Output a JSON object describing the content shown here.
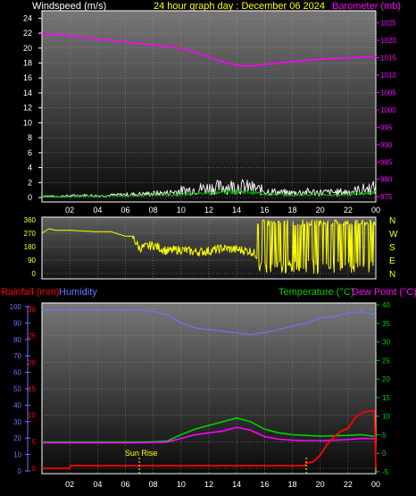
{
  "header": {
    "left_label": "Windspeed (m/s)",
    "title": "24 hour graph day : December 06 2024",
    "right_label": "Barometer (mb)"
  },
  "colors": {
    "windspeed": "#ffffff",
    "gust": "#ffffff",
    "avg_wind": "#00c000",
    "barometer": "#ff00ff",
    "direction": "#ffff00",
    "rainfall": "#ff0000",
    "humidity": "#7070ff",
    "temperature": "#00d000",
    "dewpoint": "#ff00ff",
    "title": "#ffff00",
    "text": "#ffffff"
  },
  "chart_data": [
    {
      "type": "line",
      "title": "24 hour graph day : December 06 2024",
      "xlabel": "",
      "x_ticks": [
        "02",
        "04",
        "06",
        "08",
        "10",
        "12",
        "14",
        "16",
        "18",
        "20",
        "22",
        "00"
      ],
      "xlim": [
        0,
        24
      ],
      "y_left": {
        "label": "Windspeed (m/s)",
        "ticks": [
          0,
          2,
          4,
          6,
          8,
          10,
          12,
          14,
          16,
          18,
          20,
          22,
          24
        ],
        "lim": [
          0,
          25
        ]
      },
      "y_right": {
        "label": "Barometer (mb)",
        "ticks": [
          975,
          980,
          985,
          990,
          995,
          1000,
          1005,
          1010,
          1015,
          1020,
          1025
        ],
        "lim": [
          973.5,
          1028.5
        ]
      },
      "grid": true,
      "series": [
        {
          "name": "Barometer (mb)",
          "axis": "right",
          "x": [
            0,
            1,
            2,
            3,
            4,
            5,
            6,
            7,
            8,
            9,
            10,
            11,
            12,
            13,
            14,
            15,
            16,
            17,
            18,
            19,
            20,
            21,
            22,
            23,
            24
          ],
          "values": [
            1022,
            1021.6,
            1021.2,
            1020.8,
            1020.4,
            1020,
            1019.5,
            1019.1,
            1018.6,
            1018.2,
            1017.6,
            1016.5,
            1015.2,
            1013.8,
            1012.8,
            1012.6,
            1013,
            1013.4,
            1013.9,
            1014.2,
            1014.6,
            1014.8,
            1014.9,
            1015.1,
            1015.3
          ]
        },
        {
          "axis": "left",
          "x": [
            0,
            1,
            2,
            3,
            4,
            5,
            6,
            7,
            8,
            9,
            10,
            11,
            12,
            13,
            14,
            15,
            16,
            17,
            18,
            19,
            20,
            21,
            22,
            23,
            24
          ],
          "values": [
            0.3,
            0.2,
            0.3,
            0.4,
            0.3,
            0.4,
            0.5,
            0.6,
            0.7,
            0.8,
            1.2,
            1.5,
            1.7,
            1.9,
            2.0,
            1.8,
            1.2,
            0.9,
            0.8,
            1.0,
            0.9,
            0.9,
            1.0,
            1.4,
            1.8
          ]
        },
        {
          "axis": "left",
          "x": [
            0,
            1,
            2,
            3,
            4,
            5,
            6,
            7,
            8,
            9,
            10,
            11,
            12,
            13,
            14,
            15,
            16,
            17,
            18,
            19,
            20,
            21,
            22,
            23,
            24
          ],
          "values": [
            0.1,
            0.1,
            0.1,
            0.2,
            0.2,
            0.2,
            0.2,
            0.3,
            0.3,
            0.3,
            0.4,
            0.5,
            0.6,
            0.7,
            0.8,
            0.7,
            0.5,
            0.4,
            0.3,
            0.4,
            0.4,
            0.3,
            0.4,
            0.5,
            0.7
          ]
        }
      ]
    },
    {
      "type": "line",
      "xlim": [
        0,
        24
      ],
      "y_left": {
        "ticks": [
          0,
          90,
          180,
          270,
          360
        ],
        "lim": [
          0,
          360
        ]
      },
      "y_right": {
        "ticks": [
          "N",
          "W",
          "S",
          "E",
          "N"
        ]
      },
      "grid": true,
      "series": [
        {
          "name": "Wind direction",
          "x": [
            0,
            0.5,
            1,
            2,
            3,
            4,
            5,
            6,
            6.5,
            7,
            8,
            9,
            10,
            11,
            12,
            13,
            14,
            15,
            15.5,
            16,
            16.5,
            17,
            17.5,
            18,
            18.5,
            19,
            19.5,
            20,
            20.5,
            21,
            21.5,
            22,
            22.5,
            23,
            23.5,
            24
          ],
          "values": [
            270,
            300,
            290,
            290,
            285,
            280,
            280,
            250,
            250,
            170,
            190,
            150,
            160,
            145,
            150,
            170,
            160,
            150,
            120,
            60,
            300,
            330,
            20,
            340,
            30,
            330,
            10,
            340,
            20,
            330,
            30,
            200,
            60,
            10,
            320,
            40
          ]
        }
      ]
    },
    {
      "type": "line",
      "xlim": [
        0,
        24
      ],
      "x_ticks": [
        "02",
        "04",
        "06",
        "08",
        "10",
        "12",
        "14",
        "16",
        "18",
        "20",
        "22",
        "00"
      ],
      "y_left": {
        "label": "Rainfall (mm)",
        "ticks": [
          0,
          5,
          10,
          15,
          20,
          25,
          30
        ],
        "lim": [
          -0.5,
          30.5
        ]
      },
      "y_humidity": {
        "label": "Humidity",
        "ticks": [
          0,
          10,
          20,
          30,
          40,
          50,
          60,
          70,
          80,
          90,
          100
        ],
        "lim": [
          0,
          100
        ]
      },
      "y_right": {
        "label": "Temperature (°C) Dew Point (°C)",
        "ticks": [
          -5,
          0,
          5,
          10,
          15,
          20,
          25,
          30,
          35,
          40
        ],
        "lim": [
          -5.5,
          40.5
        ]
      },
      "grid": true,
      "annotations": [
        {
          "text": "Sun Rise",
          "x": 7.0
        },
        {
          "text": "",
          "x": 19.0
        }
      ],
      "series": [
        {
          "name": "Humidity",
          "axis": "humidity",
          "x": [
            0,
            1,
            2,
            3,
            4,
            5,
            6,
            7,
            8,
            9,
            10,
            11,
            12,
            13,
            14,
            15,
            16,
            17,
            18,
            19,
            20,
            21,
            22,
            23,
            23.5,
            24
          ],
          "values": [
            98,
            98,
            98,
            98,
            98,
            98,
            98,
            98,
            97,
            95,
            90,
            87,
            86,
            85,
            84,
            83,
            84,
            86,
            88,
            90,
            93,
            94,
            96,
            97,
            96,
            95
          ]
        },
        {
          "name": "Temperature (°C)",
          "axis": "right",
          "x": [
            0,
            1,
            2,
            3,
            4,
            5,
            6,
            7,
            8,
            9,
            10,
            11,
            12,
            13,
            14,
            15,
            16,
            17,
            18,
            19,
            20,
            21,
            22,
            23,
            24
          ],
          "values": [
            3.0,
            3.0,
            3.0,
            3.0,
            3.0,
            3.0,
            3.0,
            3.0,
            3.1,
            3.3,
            5.0,
            6.5,
            7.5,
            8.5,
            9.5,
            8.5,
            6.5,
            5.5,
            5.0,
            4.8,
            4.6,
            4.7,
            4.8,
            5.0,
            4.5
          ]
        },
        {
          "name": "Dew Point (°C)",
          "axis": "right",
          "x": [
            0,
            1,
            2,
            3,
            4,
            5,
            6,
            7,
            8,
            9,
            10,
            11,
            12,
            13,
            14,
            15,
            16,
            17,
            18,
            19,
            20,
            21,
            22,
            23,
            24
          ],
          "values": [
            2.8,
            2.8,
            2.8,
            2.8,
            2.8,
            2.8,
            2.8,
            2.8,
            2.9,
            3.0,
            4.0,
            5.0,
            5.5,
            6.0,
            7.0,
            6.2,
            4.5,
            3.8,
            3.5,
            3.4,
            3.4,
            3.5,
            3.7,
            4.0,
            3.9
          ]
        },
        {
          "name": "Rainfall (mm)",
          "axis": "left",
          "x": [
            0,
            2,
            2.05,
            18.9,
            19.0,
            19.5,
            20,
            20.5,
            21,
            21.5,
            22,
            22.5,
            23,
            23.5,
            23.9,
            24
          ],
          "values": [
            0,
            0,
            0.5,
            0.5,
            1.0,
            1.2,
            2.5,
            4.5,
            6.0,
            7.0,
            7.5,
            9.5,
            10.5,
            10.8,
            10.8,
            0
          ]
        }
      ]
    }
  ],
  "labels": {
    "sunrise": "Sun Rise",
    "rain_label": "Rainfall (mm)",
    "humidity_label": "Humidity",
    "temp_label": "Temperature (°C)",
    "dew_label": "Dew Point (°C)"
  }
}
